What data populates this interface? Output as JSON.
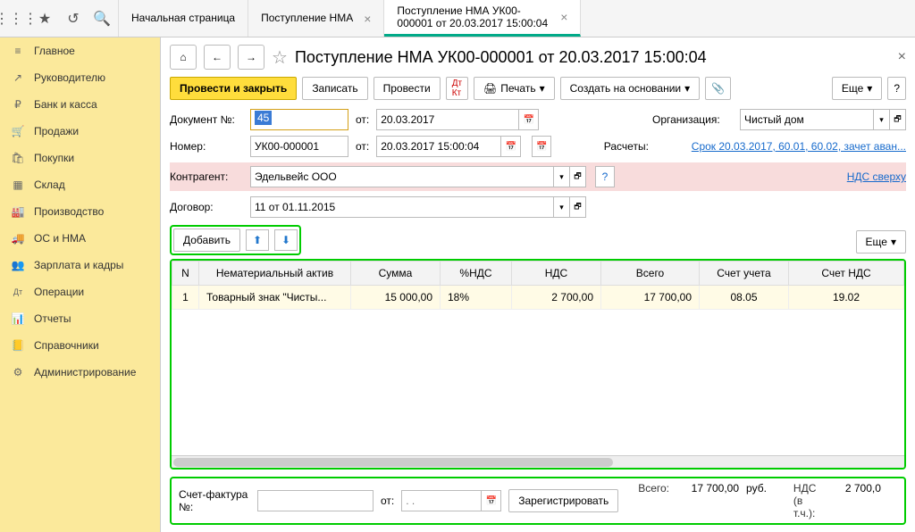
{
  "topbar": {
    "tabs": [
      {
        "label": "Начальная страница"
      },
      {
        "label": "Поступление НМА"
      },
      {
        "label": "Поступление НМА УК00-000001 от 20.03.2017 15:00:04"
      }
    ]
  },
  "sidebar": {
    "items": [
      {
        "icon": "≡",
        "label": "Главное"
      },
      {
        "icon": "↗",
        "label": "Руководителю"
      },
      {
        "icon": "₽",
        "label": "Банк и касса"
      },
      {
        "icon": "🛒",
        "label": "Продажи"
      },
      {
        "icon": "🛍",
        "label": "Покупки"
      },
      {
        "icon": "▦",
        "label": "Склад"
      },
      {
        "icon": "🏭",
        "label": "Производство"
      },
      {
        "icon": "🚚",
        "label": "ОС и НМА"
      },
      {
        "icon": "👥",
        "label": "Зарплата и кадры"
      },
      {
        "icon": "Дт",
        "label": "Операции"
      },
      {
        "icon": "📊",
        "label": "Отчеты"
      },
      {
        "icon": "📒",
        "label": "Справочники"
      },
      {
        "icon": "⚙",
        "label": "Администрирование"
      }
    ]
  },
  "page": {
    "title": "Поступление НМА УК00-000001 от 20.03.2017 15:00:04"
  },
  "toolbar": {
    "post_close": "Провести и закрыть",
    "save": "Записать",
    "post": "Провести",
    "print": "Печать",
    "create_based": "Создать на основании",
    "more": "Еще"
  },
  "form": {
    "doc_no_label": "Документ №:",
    "doc_no": "45",
    "ot": "от:",
    "doc_date": "20.03.2017",
    "org_label": "Организация:",
    "org": "Чистый дом",
    "number_label": "Номер:",
    "number": "УК00-000001",
    "datetime": "20.03.2017 15:00:04",
    "settlements_label": "Расчеты:",
    "settlements_link": "Срок 20.03.2017, 60.01, 60.02, зачет аван...",
    "counterparty_label": "Контрагент:",
    "counterparty": "Эдельвейс ООО",
    "vat_link": "НДС сверху",
    "contract_label": "Договор:",
    "contract": "11 от 01.11.2015"
  },
  "sub": {
    "add": "Добавить",
    "more": "Еще"
  },
  "table": {
    "headers": {
      "n": "N",
      "asset": "Нематериальный актив",
      "sum": "Сумма",
      "vat_pct": "%НДС",
      "vat": "НДС",
      "total": "Всего",
      "account": "Счет учета",
      "vat_account": "Счет НДС"
    },
    "rows": [
      {
        "n": "1",
        "asset": "Товарный знак \"Чисты...",
        "sum": "15 000,00",
        "vat_pct": "18%",
        "vat": "2 700,00",
        "total": "17 700,00",
        "account": "08.05",
        "vat_account": "19.02"
      }
    ]
  },
  "footer": {
    "invoice_label": "Счет-фактура №:",
    "ot": "от:",
    "date_placeholder": ". .",
    "register": "Зарегистрировать",
    "total_label": "Всего:",
    "total": "17 700,00",
    "currency": "руб.",
    "vat_label": "НДС (в т.ч.):",
    "vat": "2 700,0"
  }
}
